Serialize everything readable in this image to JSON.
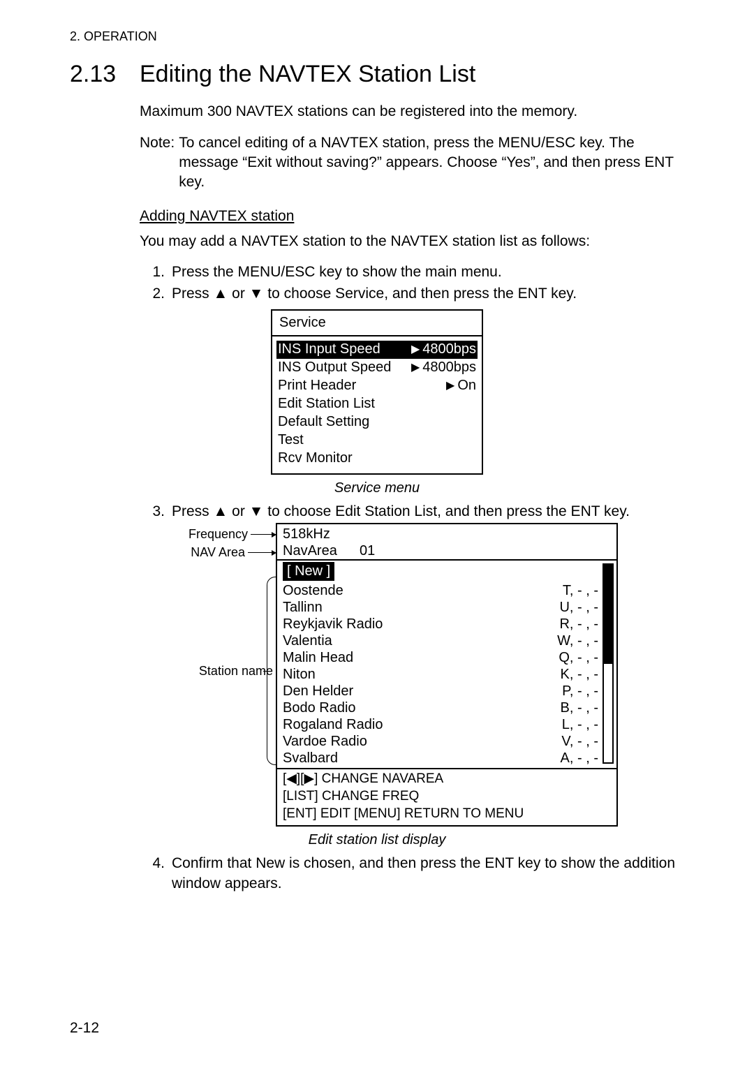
{
  "header": {
    "running_head": "2. OPERATION"
  },
  "section": {
    "number": "2.13",
    "title": "Editing the NAVTEX Station List",
    "intro": "Maximum 300 NAVTEX stations can be registered into the memory.",
    "note_label": "Note:",
    "note_text": "To cancel editing of a NAVTEX station, press the MENU/ESC key. The message “Exit without saving?” appears. Choose “Yes”, and then press ENT key.",
    "subhead": "Adding NAVTEX station",
    "sub_intro": "You may add a NAVTEX station to the NAVTEX station list as follows:"
  },
  "steps": {
    "s1_num": "1.",
    "s1": "Press the MENU/ESC key to show the main menu.",
    "s2_num": "2.",
    "s2_a": "Press ",
    "s2_b": " or ",
    "s2_c": " to choose Service, and then press the ENT key.",
    "s3_num": "3.",
    "s3_a": "Press ",
    "s3_b": " or ",
    "s3_c": " to choose Edit Station List, and then press the ENT key.",
    "s4_num": "4.",
    "s4": "Confirm that New is chosen, and then press the ENT key to show the addition window appears."
  },
  "service_menu": {
    "title": "Service",
    "rows": [
      {
        "label": "INS Input Speed",
        "value": "4800bps",
        "selected": true
      },
      {
        "label": "INS Output Speed",
        "value": "4800bps",
        "selected": false
      },
      {
        "label": "Print Header",
        "value": "On",
        "selected": false
      },
      {
        "label": "Edit Station List",
        "value": "",
        "selected": false
      },
      {
        "label": "Default Setting",
        "value": "",
        "selected": false
      },
      {
        "label": "Test",
        "value": "",
        "selected": false
      },
      {
        "label": "Rcv Monitor",
        "value": "",
        "selected": false
      }
    ],
    "caption": "Service menu"
  },
  "esl": {
    "callout_frequency": "Frequency",
    "callout_navarea": "NAV Area",
    "callout_station": "Station name",
    "freq_value": "518kHz",
    "navarea_label": "NavArea",
    "navarea_value": "01",
    "new_label": "[ New ]",
    "stations": [
      {
        "name": "Oostende",
        "code": "T,  - , -"
      },
      {
        "name": "Tallinn",
        "code": "U, - , -"
      },
      {
        "name": "Reykjavik Radio",
        "code": "R, - , -"
      },
      {
        "name": "Valentia",
        "code": "W, - , -"
      },
      {
        "name": "Malin Head",
        "code": "Q, - , -"
      },
      {
        "name": "Niton",
        "code": "K, - , -"
      },
      {
        "name": "Den Helder",
        "code": "P,  - , -"
      },
      {
        "name": "Bodo Radio",
        "code": "B,  - , -"
      },
      {
        "name": "Rogaland Radio",
        "code": "L,  - , -"
      },
      {
        "name": "Vardoe Radio",
        "code": "V,  - , -"
      },
      {
        "name": "Svalbard",
        "code": "A,  - , -"
      }
    ],
    "footer_line1_mid": " CHANGE NAVAREA",
    "footer_line2": "[LIST] CHANGE FREQ",
    "footer_line3": "[ENT] EDIT    [MENU] RETURN TO MENU",
    "caption": "Edit station list display"
  },
  "page_number": "2-12"
}
